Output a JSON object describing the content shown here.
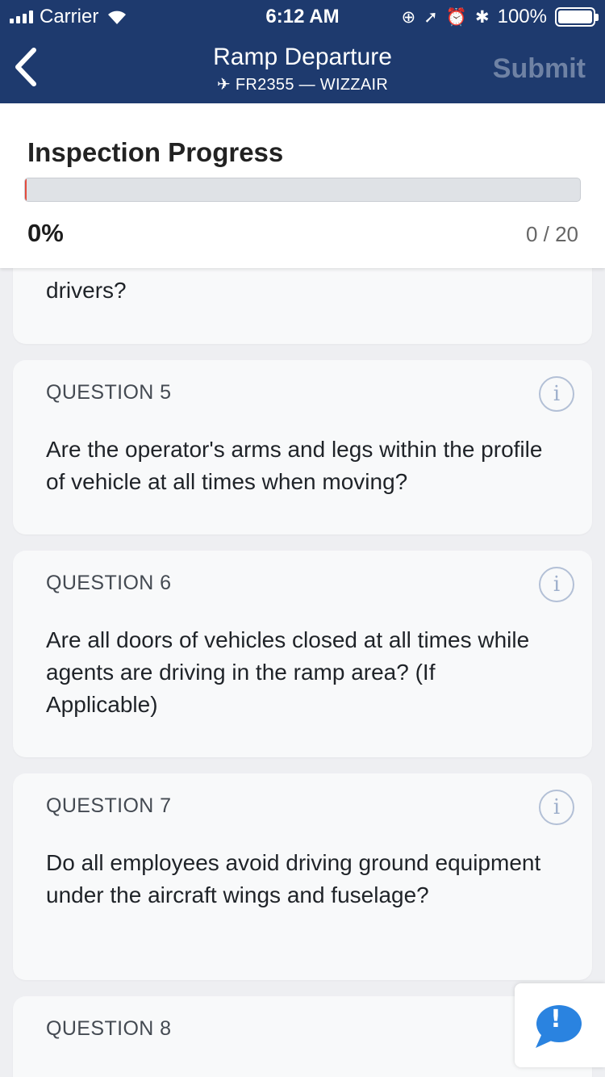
{
  "status_bar": {
    "carrier": "Carrier",
    "time": "6:12 AM",
    "battery": "100%"
  },
  "nav": {
    "title": "Ramp Departure",
    "subtitle": "✈ FR2355 — WIZZAIR",
    "submit_label": "Submit"
  },
  "progress": {
    "title": "Inspection Progress",
    "percent_label": "0%",
    "count_label": "0 / 20",
    "fraction": 0
  },
  "questions": [
    {
      "label": "",
      "text": "drivers?"
    },
    {
      "label": "QUESTION 5",
      "text": "Are the operator's arms and legs within the profile of vehicle at all times when moving?"
    },
    {
      "label": "QUESTION 6",
      "text": "Are all doors of vehicles closed at all times while agents are driving in the ramp area? (If Applicable)"
    },
    {
      "label": "QUESTION 7",
      "text": "Do all employees avoid driving ground equipment under the aircraft wings and fuselage?"
    },
    {
      "label": "QUESTION 8",
      "text": ""
    }
  ],
  "feedback": {
    "mark": "!"
  },
  "colors": {
    "header": "#1e3a6e",
    "progress_fill": "#e34b3d",
    "feedback_accent": "#2a83e0",
    "submit_disabled": "#6f82a4"
  }
}
